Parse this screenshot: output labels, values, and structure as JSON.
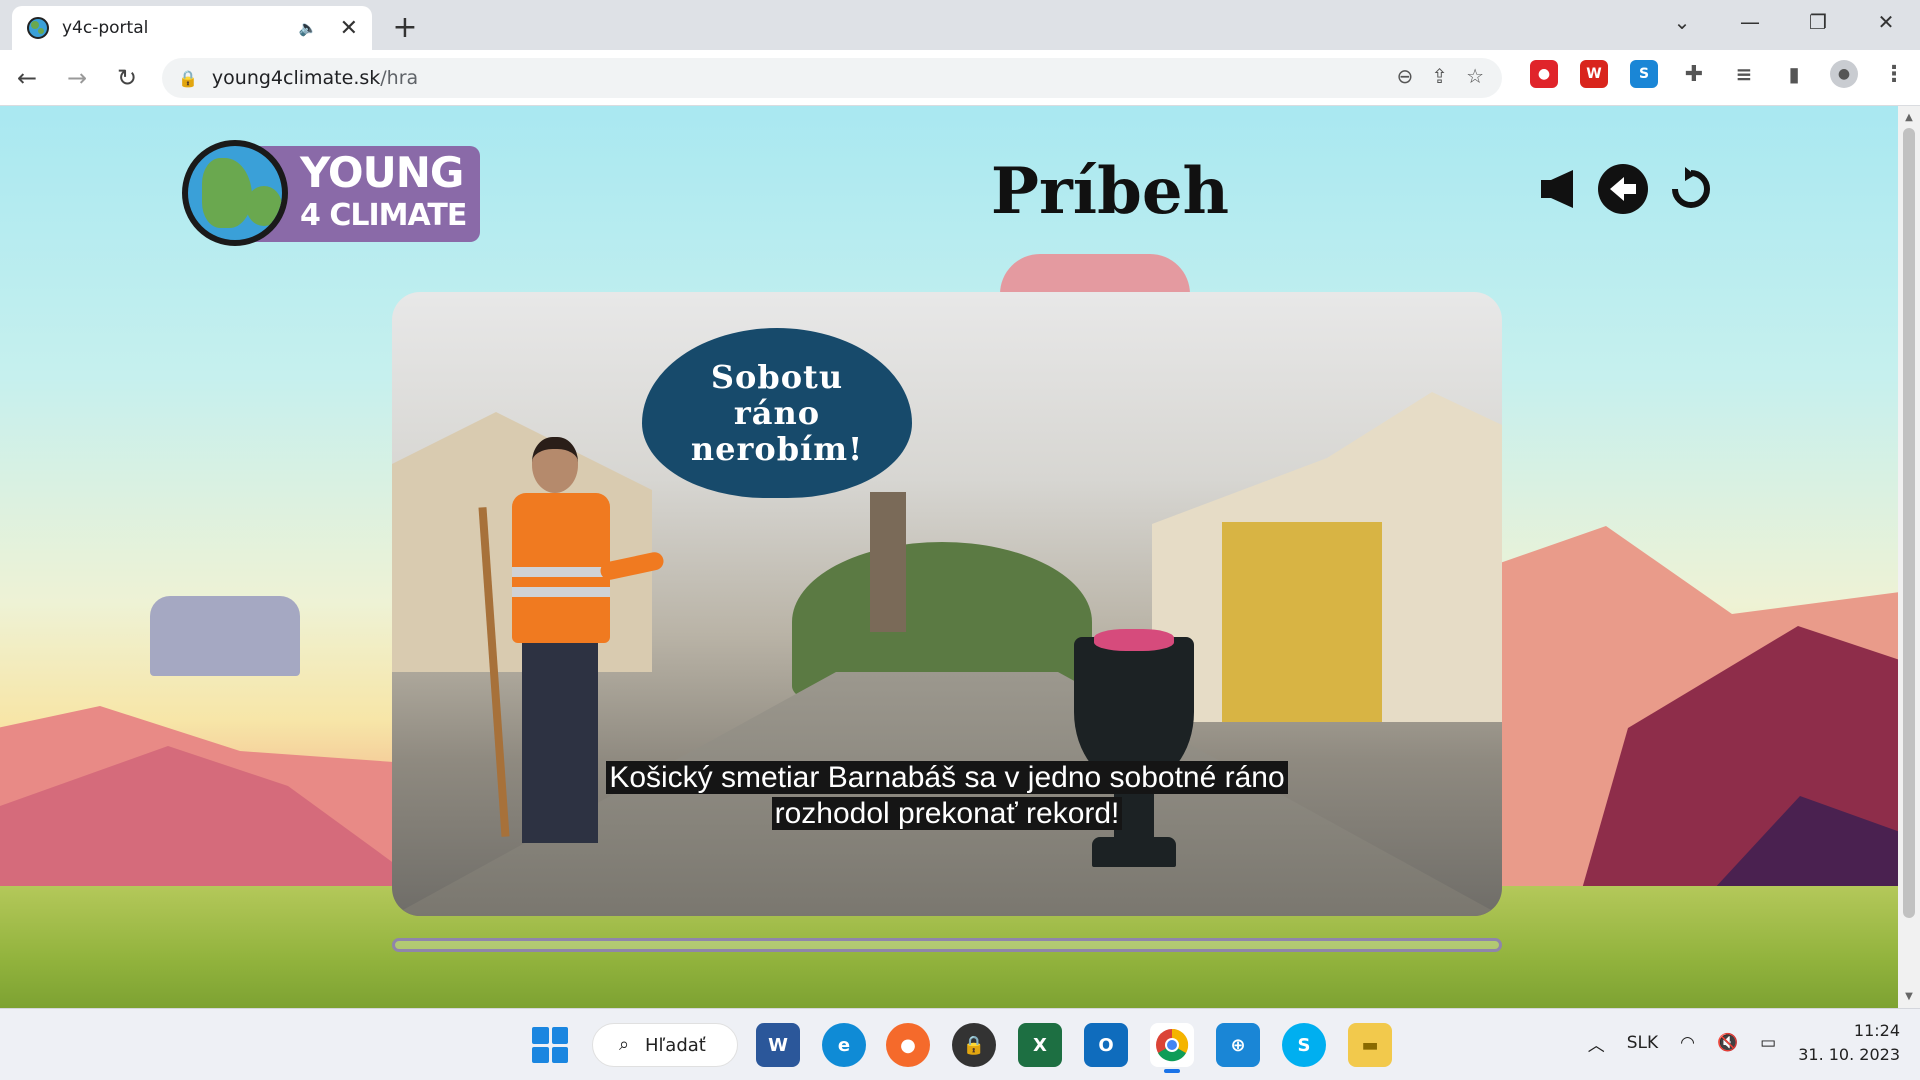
{
  "browser": {
    "tab_title": "y4c-portal",
    "new_tab": "+",
    "url_host": "young4climate.sk",
    "url_path": "/hra"
  },
  "page": {
    "logo_line1": "YOUNG",
    "logo_line2": "4 CLIMATE",
    "title": "Príbeh",
    "speech_bubble": "Sobotu\nráno\nnerobím!",
    "subtitle": "Košický smetiar Barnabáš sa v jedno sobotné ráno\nrozhodol prekonať rekord!",
    "progress": 0.0
  },
  "taskbar": {
    "search_label": "Hľadať",
    "language": "SLK",
    "time": "11:24",
    "date": "31. 10. 2023"
  },
  "colors": {
    "logo_banner": "#8a6aa8",
    "bubble": "#174a6b",
    "progress": "#8f85aa"
  },
  "icons": {
    "sound": "speaker-icon",
    "back": "arrow-left-icon",
    "restart": "restart-icon"
  }
}
